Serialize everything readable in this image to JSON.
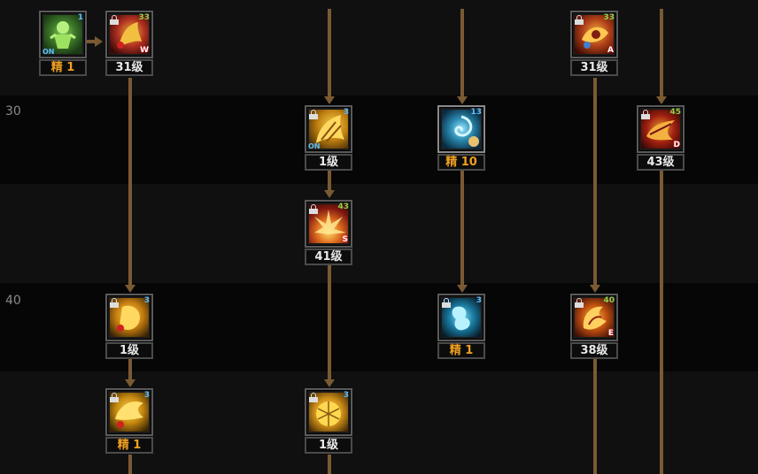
{
  "rows": [
    {
      "label": "30"
    },
    {
      "label": "40"
    }
  ],
  "colors": {
    "background": "#101010",
    "band": "#050505",
    "connector": "#7a5a33",
    "level_text": "#eaeaea",
    "elite_text": "#f0a020",
    "badge_blue": "#5fc0ff",
    "badge_green": "#8fd14f"
  },
  "skills": [
    {
      "id": "s1",
      "icon": "green-doll-icon",
      "badge": "1",
      "badge_color": "blue",
      "on": "ON",
      "level": "精 1",
      "elite": true,
      "locked": false,
      "letter": ""
    },
    {
      "id": "s2",
      "icon": "red-beast-icon",
      "badge": "33",
      "badge_color": "green",
      "on": "",
      "level": "31级",
      "elite": false,
      "locked": true,
      "letter": "W"
    },
    {
      "id": "s3",
      "icon": "golden-claw-icon",
      "badge": "3",
      "badge_color": "blue",
      "on": "ON",
      "level": "1级",
      "elite": false,
      "locked": true,
      "letter": ""
    },
    {
      "id": "s4",
      "icon": "explosion-icon",
      "badge": "43",
      "badge_color": "green",
      "on": "",
      "level": "41级",
      "elite": false,
      "locked": true,
      "letter": "S"
    },
    {
      "id": "s5",
      "icon": "golden-bird-icon",
      "badge": "3",
      "badge_color": "blue",
      "on": "",
      "level": "1级",
      "elite": false,
      "locked": true,
      "letter": ""
    },
    {
      "id": "s6",
      "icon": "golden-hatch-icon",
      "badge": "3",
      "badge_color": "blue",
      "on": "",
      "level": "1级",
      "elite": false,
      "locked": true,
      "letter": ""
    },
    {
      "id": "s7",
      "icon": "blue-swirl-icon",
      "badge": "13",
      "badge_color": "blue",
      "on": "",
      "level": "精 10",
      "elite": true,
      "locked": false,
      "letter": ""
    },
    {
      "id": "s8",
      "icon": "blue-spirit-icon",
      "badge": "3",
      "badge_color": "blue",
      "on": "",
      "level": "精 1",
      "elite": true,
      "locked": true,
      "letter": ""
    },
    {
      "id": "s9",
      "icon": "fire-eye-icon",
      "badge": "33",
      "badge_color": "green",
      "on": "",
      "level": "31级",
      "elite": false,
      "locked": true,
      "letter": "A"
    },
    {
      "id": "s10",
      "icon": "fire-dragon-icon",
      "badge": "40",
      "badge_color": "green",
      "on": "",
      "level": "38级",
      "elite": false,
      "locked": true,
      "letter": "E"
    },
    {
      "id": "s11",
      "icon": "red-whirl-icon",
      "badge": "45",
      "badge_color": "green",
      "on": "",
      "level": "43级",
      "elite": false,
      "locked": true,
      "letter": "D"
    },
    {
      "id": "s12",
      "icon": "golden-fist-icon",
      "badge": "3",
      "badge_color": "blue",
      "on": "",
      "level": "精 1",
      "elite": true,
      "locked": true,
      "letter": ""
    }
  ]
}
